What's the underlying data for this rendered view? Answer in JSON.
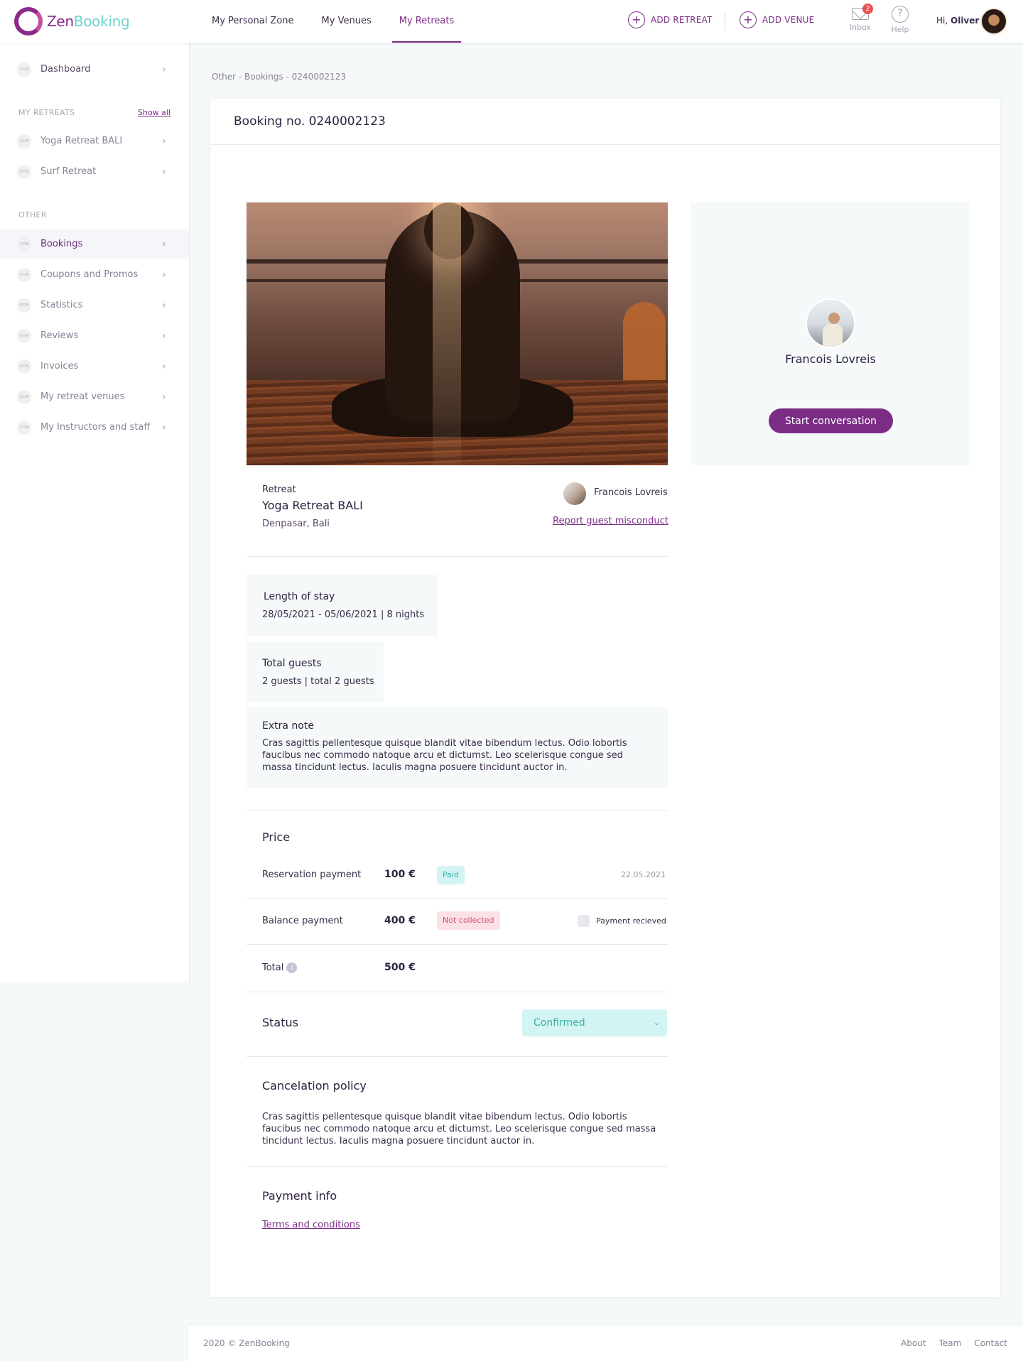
{
  "brand": {
    "name_a": "Zen",
    "name_b": "Booking"
  },
  "nav": {
    "items": [
      "My Personal Zone",
      "My Venues",
      "My Retreats"
    ]
  },
  "actions": {
    "add_retreat": "ADD RETREAT",
    "add_venue": "ADD VENUE",
    "plus": "+"
  },
  "inbox": {
    "label": "Inbox",
    "count": "2"
  },
  "help": {
    "label": "Help",
    "glyph": "?"
  },
  "user": {
    "greeting": "Hi,",
    "name": "Oliver"
  },
  "sidebar": {
    "icon_text": "ICON",
    "chevron": "›",
    "dashboard": "Dashboard",
    "my_retreats_heading": "MY RETREATS",
    "show_all": "Show all",
    "retreats": [
      "Yoga Retreat BALI",
      "Surf Retreat"
    ],
    "other_heading": "OTHER",
    "other": [
      "Bookings",
      "Coupons and Promos",
      "Statistics",
      "Reviews",
      "Invoices",
      "My retreat venues",
      "My Instructors and staff"
    ]
  },
  "breadcrumb": "Other - Bookings - 0240002123",
  "booking": {
    "title": "Booking no. 0240002123",
    "host_name": "Francois Lovreis",
    "start_conversation": "Start conversation",
    "retreat_kicker": "Retreat",
    "retreat_name": "Yoga Retreat BALI",
    "retreat_location": "Denpasar, Bali",
    "guest_name": "Francois Lovreis",
    "report_link": "Report guest misconduct",
    "length_heading": "Length of stay",
    "length_value": "28/05/2021 - 05/06/2021 | 8 nights",
    "guests_heading": "Total guests",
    "guests_value": "2 guests | total 2 guests",
    "note_heading": "Extra note",
    "note_text": "Cras sagittis pellentesque quisque blandit vitae bibendum lectus. Odio lobortis faucibus nec commodo natoque arcu et dictumst. Leo scelerisque congue sed massa tincidunt lectus. Iaculis magna posuere tincidunt auctor in.",
    "price_heading": "Price",
    "reservation_label": "Reservation payment",
    "reservation_amount": "100 €",
    "reservation_status": "Paid",
    "reservation_date": "22.05.2021",
    "balance_label": "Balance payment",
    "balance_amount": "400 €",
    "balance_status": "Not collected",
    "payment_received_label": "Payment recieved",
    "total_label": "Total",
    "total_amount": "500 €",
    "status_heading": "Status",
    "status_value": "Confirmed",
    "cancel_heading": "Cancelation policy",
    "cancel_text": "Cras sagittis pellentesque quisque blandit vitae bibendum lectus. Odio lobortis faucibus nec commodo natoque arcu et dictumst. Leo scelerisque congue sed massa tincidunt lectus. Iaculis magna posuere tincidunt auctor in.",
    "payment_heading": "Payment info",
    "terms_link": "Terms and conditions"
  },
  "footer": {
    "copy": "2020 © ZenBooking",
    "links": [
      "About",
      "Team",
      "Contact"
    ]
  },
  "colors": {
    "accent": "#7b2d86",
    "teal": "#6fd2cc",
    "paid_bg": "#d2f4f2",
    "not_collected_bg": "#fbe1e5"
  }
}
